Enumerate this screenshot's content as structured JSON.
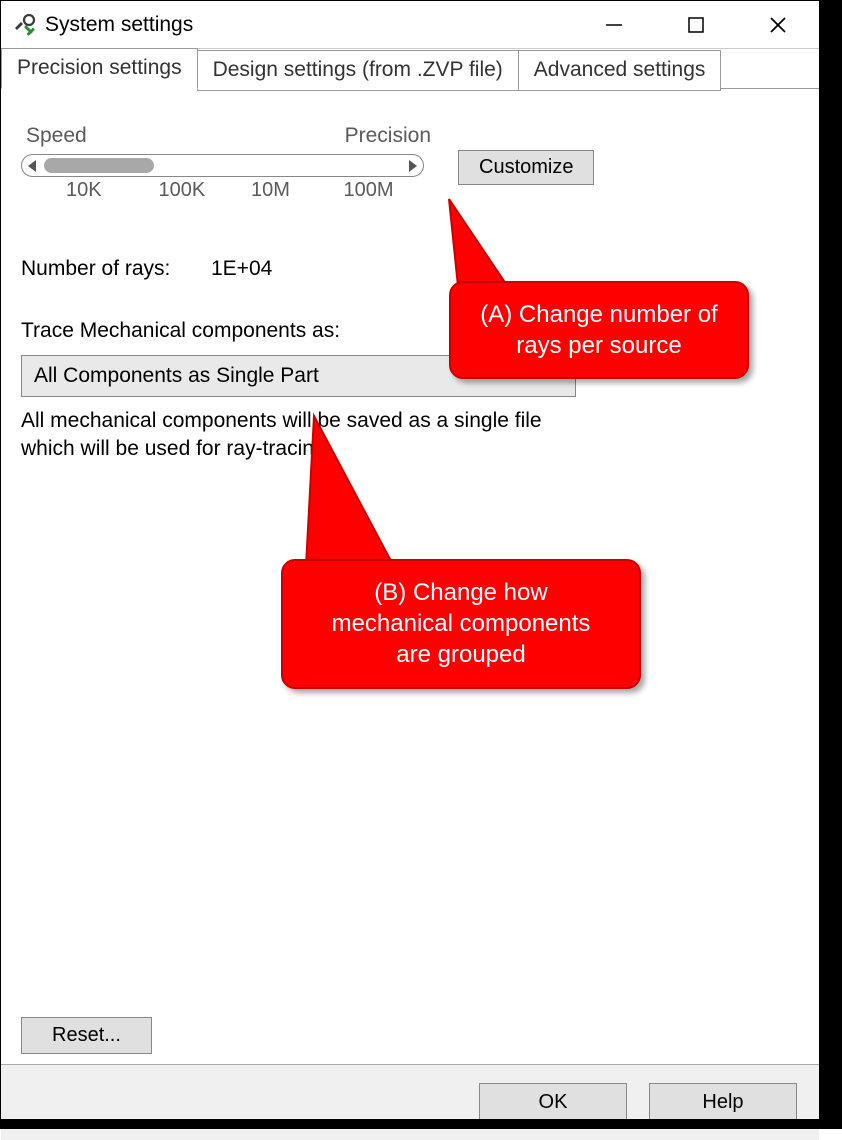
{
  "titlebar": {
    "title": "System settings"
  },
  "tabs": [
    {
      "label": "Precision settings"
    },
    {
      "label": "Design settings (from .ZVP file)"
    },
    {
      "label": "Advanced settings"
    }
  ],
  "slider": {
    "left_label": "Speed",
    "right_label": "Precision",
    "ticks": [
      "10K",
      "100K",
      "10M",
      "100M"
    ],
    "customize_label": "Customize"
  },
  "num_rays": {
    "label": "Number of rays:",
    "value": "1E+04"
  },
  "trace": {
    "label": "Trace Mechanical components as:",
    "selected": "All Components as Single Part",
    "description": "All mechanical components will be saved as a single file which will be used for ray-tracing."
  },
  "buttons": {
    "reset": "Reset...",
    "ok": "OK",
    "help": "Help"
  },
  "callouts": {
    "a": "(A) Change number of rays per source",
    "b": "(B) Change how mechanical components are grouped"
  }
}
